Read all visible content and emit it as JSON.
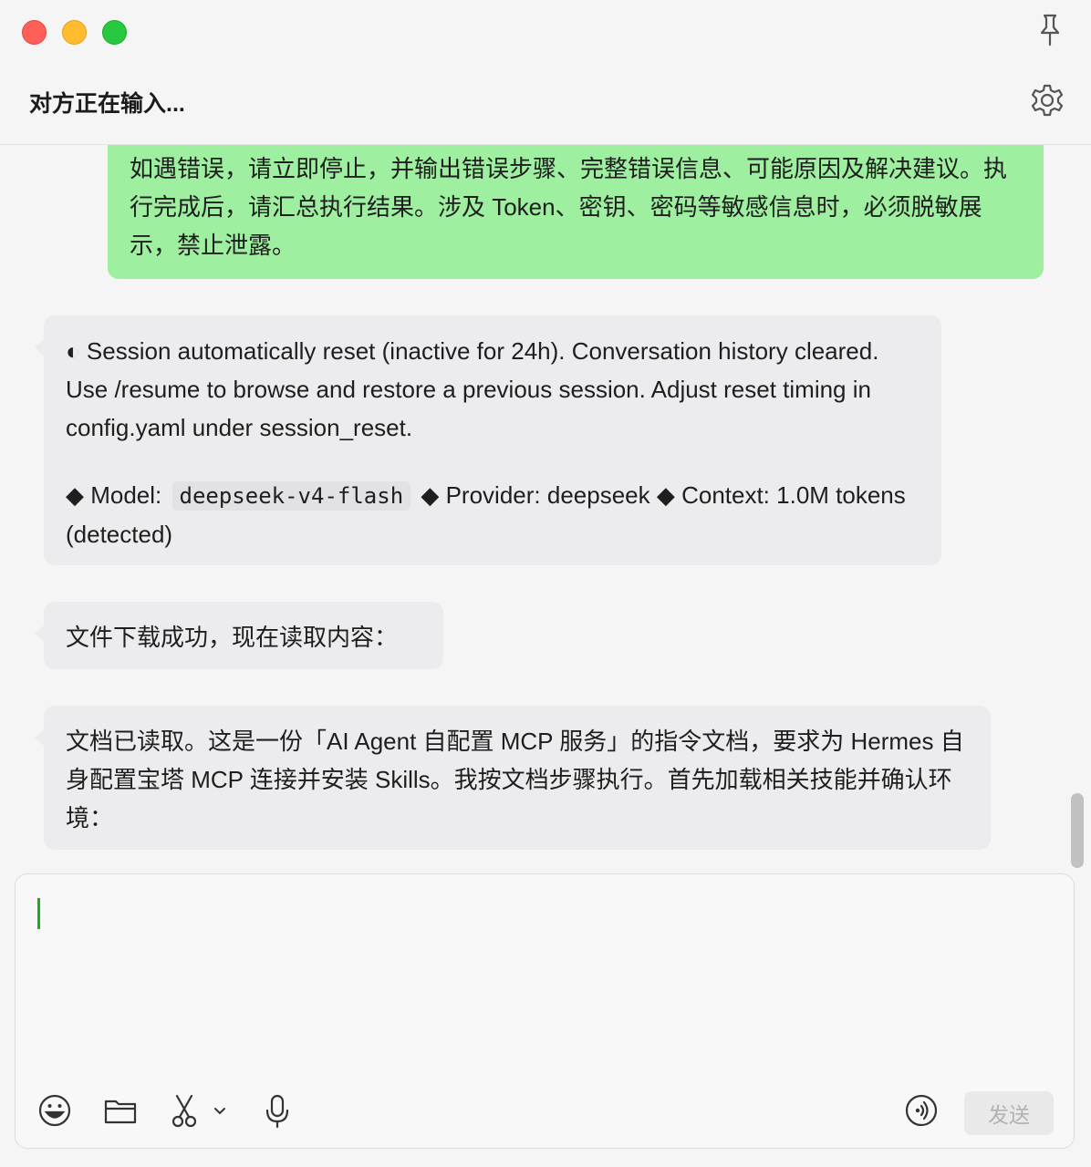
{
  "window": {
    "title": "对方正在输入..."
  },
  "messages": {
    "user": {
      "text": "如遇错误，请立即停止，并输出错误步骤、完整错误信息、可能原因及解决建议。执行完成后，请汇总执行结果。涉及 Token、密钥、密码等敏感信息时，必须脱敏展示，禁止泄露。"
    },
    "session_reset": {
      "text": "◐ Session automatically reset (inactive for 24h). Conversation history cleared. Use /resume to browse and restore a previous session. Adjust reset timing in config.yaml under session_reset.",
      "model_label": "◆ Model:",
      "model_value": "deepseek-v4-flash",
      "provider": "◆ Provider: deepseek",
      "context": "◆ Context: 1.0M tokens (detected)"
    },
    "download": {
      "text": "文件下载成功，现在读取内容："
    },
    "reading": {
      "text": "文档已读取。这是一份「AI Agent 自配置 MCP 服务」的指令文档，要求为 Hermes 自身配置宝塔 MCP 连接并安装 Skills。我按文档步骤执行。首先加载相关技能并确认环境："
    }
  },
  "composer": {
    "value": "",
    "send_label": "发送"
  },
  "icons": {
    "pin": "pin-icon",
    "settings": "gear-icon",
    "emoji": "emoji-icon",
    "folder": "folder-icon",
    "screenshot": "scissors-icon",
    "voice": "microphone-icon",
    "voice_call": "voice-call-icon"
  },
  "colors": {
    "user_bubble": "#9eef9f",
    "incoming_bubble": "#ececee",
    "caret": "#1aad19"
  }
}
